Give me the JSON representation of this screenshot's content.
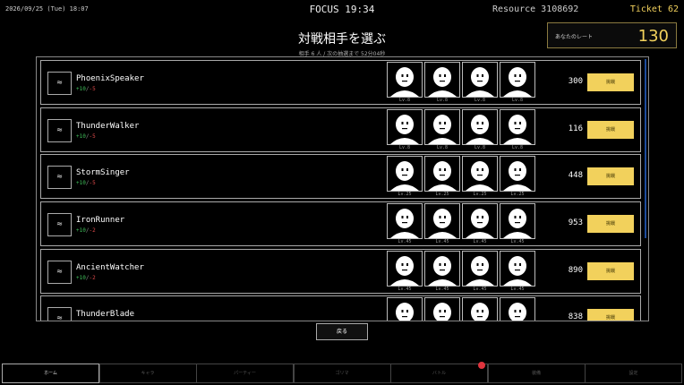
{
  "topbar": {
    "datetime": "2026/09/25 (Tue) 18:07",
    "focus": "FOCUS 19:34",
    "resource": "Resource 3108692",
    "ticket": "Ticket 62"
  },
  "header": {
    "title": "対戦相手を選ぶ",
    "subtitle": "相手 6 人 / 次の抽選まで 52分04秒"
  },
  "rate": {
    "label": "あなたのレート",
    "value": "130"
  },
  "opponents": [
    {
      "name": "PhoenixSpeaker",
      "win": "+10",
      "loss": "-5",
      "score": "300",
      "lv": "Lv.8",
      "button": "挑戦"
    },
    {
      "name": "ThunderWalker",
      "win": "+10",
      "loss": "-5",
      "score": "116",
      "lv": "Lv.8",
      "button": "挑戦"
    },
    {
      "name": "StormSinger",
      "win": "+10",
      "loss": "-5",
      "score": "448",
      "lv": "Lv.25",
      "button": "挑戦"
    },
    {
      "name": "IronRunner",
      "win": "+10",
      "loss": "-2",
      "score": "953",
      "lv": "Lv.45",
      "button": "挑戦"
    },
    {
      "name": "AncientWatcher",
      "win": "+10",
      "loss": "-2",
      "score": "890",
      "lv": "Lv.45",
      "button": "挑戦"
    },
    {
      "name": "ThunderBlade",
      "win": "",
      "loss": "",
      "score": "838",
      "lv": "",
      "button": "挑戦"
    }
  ],
  "emblem_icon": "waves-icon",
  "back_button": "戻る",
  "nav": [
    "ホーム",
    "キャラ",
    "パーティー",
    "ゴリマ",
    "バトル",
    "装備",
    "設定"
  ],
  "colors": {
    "accent": "#f2d15c",
    "win": "#3fbf5a",
    "loss": "#e04b4b",
    "notification": "#e0343e",
    "scrollbar": "#1d4d9e"
  }
}
